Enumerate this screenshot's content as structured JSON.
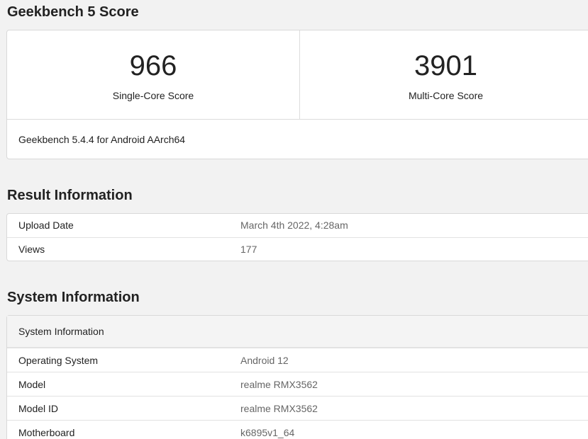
{
  "score_section": {
    "title": "Geekbench 5 Score",
    "single_core_score": "966",
    "single_core_label": "Single-Core Score",
    "multi_core_score": "3901",
    "multi_core_label": "Multi-Core Score",
    "version": "Geekbench 5.4.4 for Android AArch64"
  },
  "result_section": {
    "title": "Result Information",
    "rows": [
      {
        "key": "Upload Date",
        "value": "March 4th 2022, 4:28am"
      },
      {
        "key": "Views",
        "value": "177"
      }
    ]
  },
  "system_section": {
    "title": "System Information",
    "table_header": "System Information",
    "rows": [
      {
        "key": "Operating System",
        "value": "Android 12"
      },
      {
        "key": "Model",
        "value": "realme RMX3562"
      },
      {
        "key": "Model ID",
        "value": "realme RMX3562"
      },
      {
        "key": "Motherboard",
        "value": "k6895v1_64"
      }
    ]
  }
}
